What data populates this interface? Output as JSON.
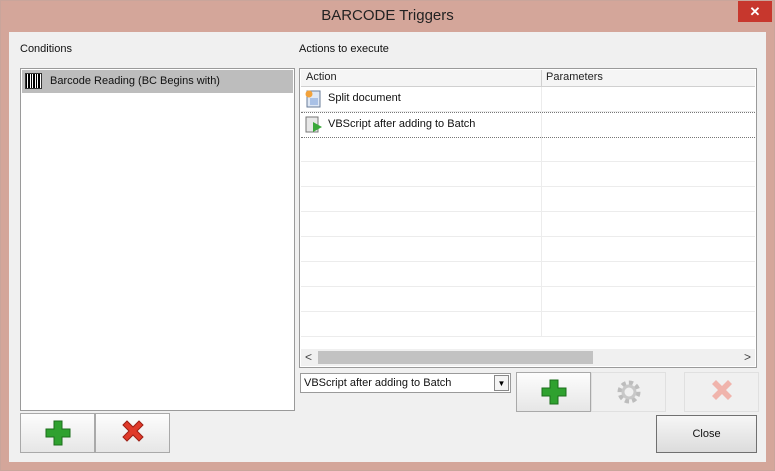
{
  "window": {
    "title": "BARCODE Triggers",
    "close_glyph": "✕"
  },
  "conditions": {
    "label": "Conditions",
    "items": [
      {
        "label": "Barcode Reading (BC Begins with)",
        "icon": "barcode-icon"
      }
    ]
  },
  "actions": {
    "label": "Actions to execute",
    "columns": [
      "Action",
      "Parameters"
    ],
    "rows": [
      {
        "action": "Split document",
        "parameters": "",
        "icon": "split-document-icon"
      },
      {
        "action": "VBScript after adding to Batch",
        "parameters": "",
        "icon": "vbscript-icon"
      }
    ],
    "scroll_left": "<",
    "scroll_right": ">"
  },
  "action_combo": {
    "value": "VBScript after adding to Batch",
    "dropdown_glyph": "▼"
  },
  "buttons": {
    "close": "Close"
  },
  "colors": {
    "title_bar": "#d4a69a",
    "selected_row": "#bdbdbd",
    "close_red": "#c7372d",
    "plus_green": "#2fa12f",
    "delete_red": "#e03a2a"
  }
}
